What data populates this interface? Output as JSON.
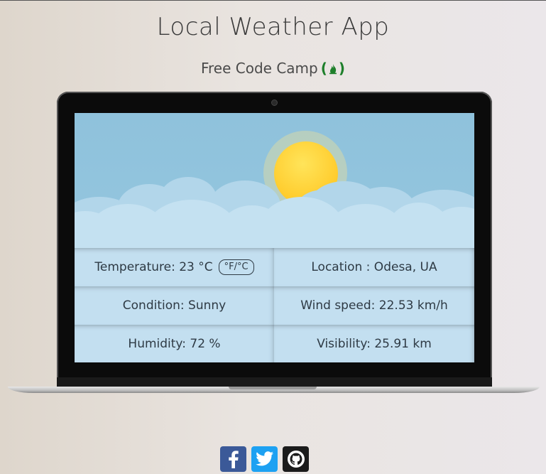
{
  "header": {
    "title": "Local Weather App",
    "subtitle": "Free Code Camp",
    "fcc_icon": "freecodecamp-fire-icon"
  },
  "weather": {
    "temperature_label": "Temperature: 23 °C",
    "unit_toggle": "°F/°C",
    "location_label": "Location : Odesa, UA",
    "condition_label": "Condition: Sunny",
    "wind_label": "Wind speed: 22.53 km/h",
    "humidity_label": "Humidity: 72 %",
    "visibility_label": "Visibility: 25.91 km"
  },
  "social": {
    "icons": [
      "facebook-icon",
      "twitter-icon",
      "github-icon"
    ]
  },
  "colors": {
    "sky": "#8fc2dc",
    "sun": "#ffcb2b",
    "cell": "#c3dff0",
    "facebook": "#3b5998",
    "twitter": "#1da1f2",
    "github": "#1b1b1b",
    "fcc_green": "#1e7f2b"
  }
}
